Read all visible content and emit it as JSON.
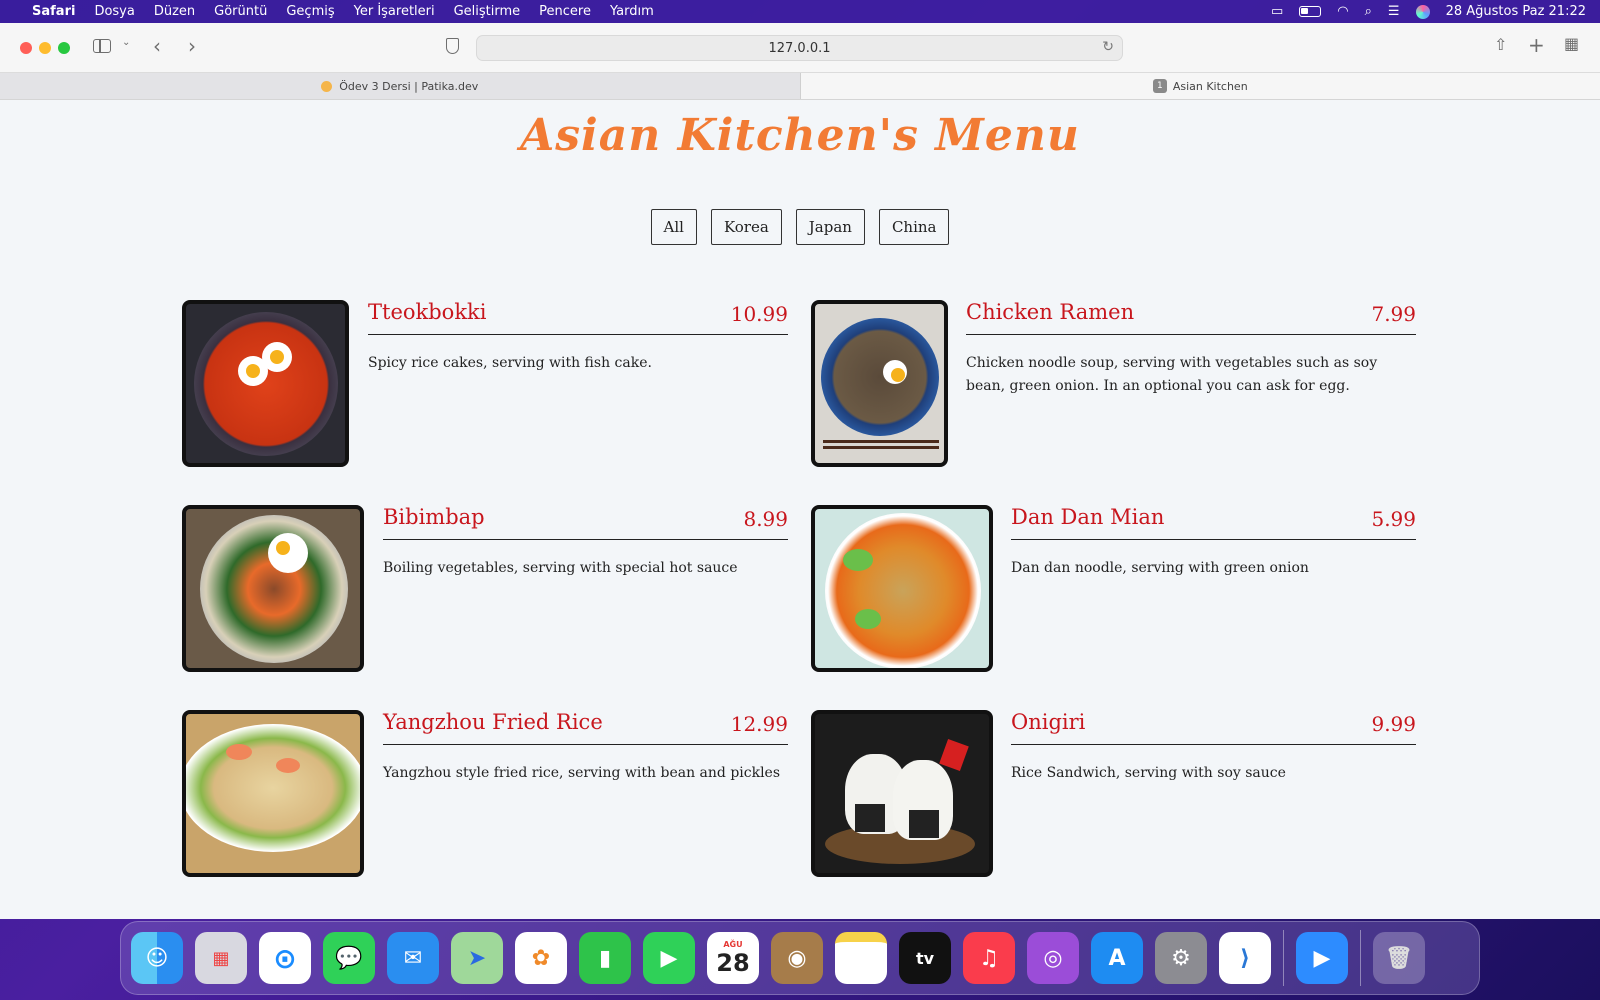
{
  "menubar": {
    "app": "Safari",
    "items": [
      "Dosya",
      "Düzen",
      "Görüntü",
      "Geçmiş",
      "Yer İşaretleri",
      "Geliştirme",
      "Pencere",
      "Yardım"
    ],
    "datetime": "28 Ağustos Paz  21:22"
  },
  "browser": {
    "address": "127.0.0.1",
    "tabs": [
      {
        "label": "Ödev 3 Dersi | Patika.dev"
      },
      {
        "label": "Asian Kitchen",
        "badge": "1"
      }
    ]
  },
  "page": {
    "title": "Asian Kitchen's Menu",
    "filters": [
      "All",
      "Korea",
      "Japan",
      "China"
    ],
    "menu": [
      {
        "name": "Tteokbokki",
        "price": "10.99",
        "desc": "Spicy rice cakes, serving with fish cake."
      },
      {
        "name": "Chicken Ramen",
        "price": "7.99",
        "desc": "Chicken noodle soup, serving with vegetables such as soy bean, green onion. In an optional you can ask for egg."
      },
      {
        "name": "Bibimbap",
        "price": "8.99",
        "desc": "Boiling vegetables, serving with special hot sauce"
      },
      {
        "name": "Dan Dan Mian",
        "price": "5.99",
        "desc": "Dan dan noodle, serving with green onion"
      },
      {
        "name": "Yangzhou Fried Rice",
        "price": "12.99",
        "desc": "Yangzhou style fried rice, serving with bean and pickles"
      },
      {
        "name": "Onigiri",
        "price": "9.99",
        "desc": "Rice Sandwich, serving with soy sauce"
      }
    ]
  },
  "dock": {
    "calendar_month": "AĞU",
    "calendar_day": "28",
    "tv_label": "tv"
  },
  "colors": {
    "accent_title": "#f27b34",
    "item_name": "#c8161d"
  }
}
